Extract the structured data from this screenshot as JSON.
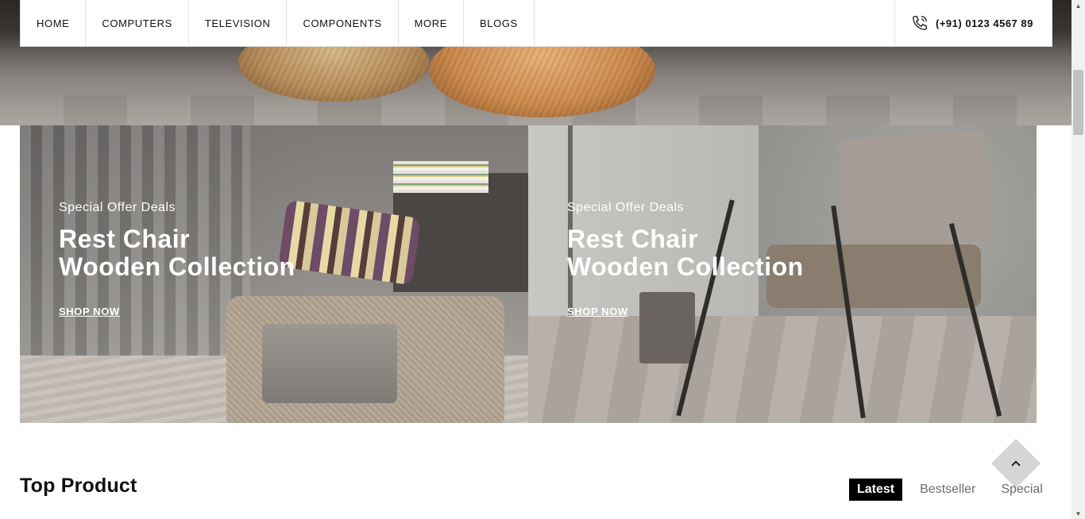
{
  "nav": {
    "items": [
      {
        "label": "HOME"
      },
      {
        "label": "COMPUTERS"
      },
      {
        "label": "TELEVISION"
      },
      {
        "label": "COMPONENTS"
      },
      {
        "label": "MORE"
      },
      {
        "label": "BLOGS"
      }
    ],
    "phone": "(+91) 0123 4567 89",
    "phone_icon": "phone-icon"
  },
  "banners": [
    {
      "kicker": "Special Offer Deals",
      "title_line1": "Rest Chair",
      "title_line2": "Wooden Collection",
      "cta": "SHOP NOW"
    },
    {
      "kicker": "Special Offer Deals",
      "title_line1": "Rest Chair",
      "title_line2": "Wooden Collection",
      "cta": "SHOP NOW"
    }
  ],
  "top_product": {
    "title": "Top Product",
    "tabs": [
      {
        "label": "Latest",
        "active": true
      },
      {
        "label": "Bestseller",
        "active": false
      },
      {
        "label": "Special",
        "active": false
      }
    ]
  },
  "colors": {
    "accent": "#000000",
    "tab_inactive": "#6b6b6b",
    "back_to_top": "#d6d6d6"
  },
  "icons": {
    "back_to_top": "chevron-up-icon"
  }
}
